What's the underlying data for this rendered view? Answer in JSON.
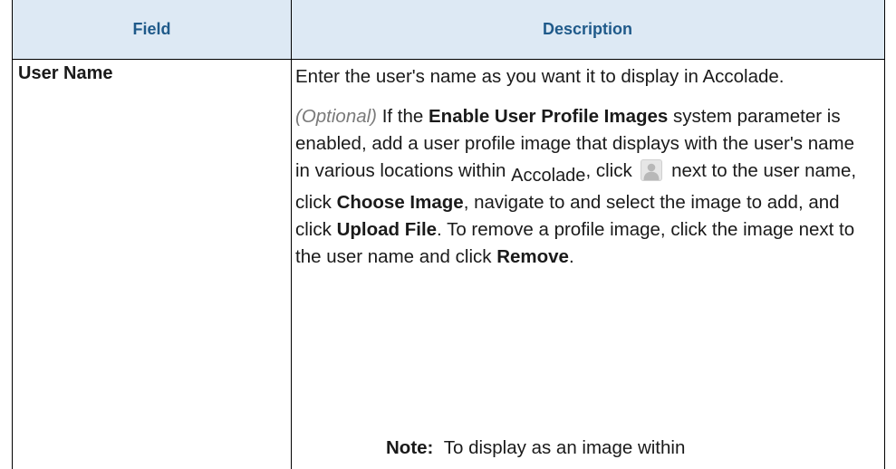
{
  "table": {
    "headers": {
      "field": "Field",
      "description": "Description"
    },
    "row": {
      "field": "User Name",
      "description_p1": "Enter the user's name as you want it to display in Accolade.",
      "description_p2": {
        "optional": "(Optional)",
        "t1": " If the ",
        "b1": "Enable User Profile Images",
        "t2": " system parameter is enabled, add a user profile image that displays with the user's name in various locations within ",
        "accolade": "Accolade",
        "t3": ", click ",
        "icon": "user-profile-icon",
        "t4": " next to the user name, click ",
        "b2": "Choose Image",
        "t5": ", navigate to and select the image to add, and click ",
        "b3": "Upload File",
        "t6": ". To remove a profile image, click the image next to the user name and click ",
        "b4": "Remove",
        "t7": "."
      },
      "note": {
        "label": "Note:",
        "text": "To display as an image within"
      }
    }
  },
  "colors": {
    "header_bg": "#dde9f4",
    "header_text": "#1f5a8a",
    "optional_text": "#7a7a7a"
  }
}
